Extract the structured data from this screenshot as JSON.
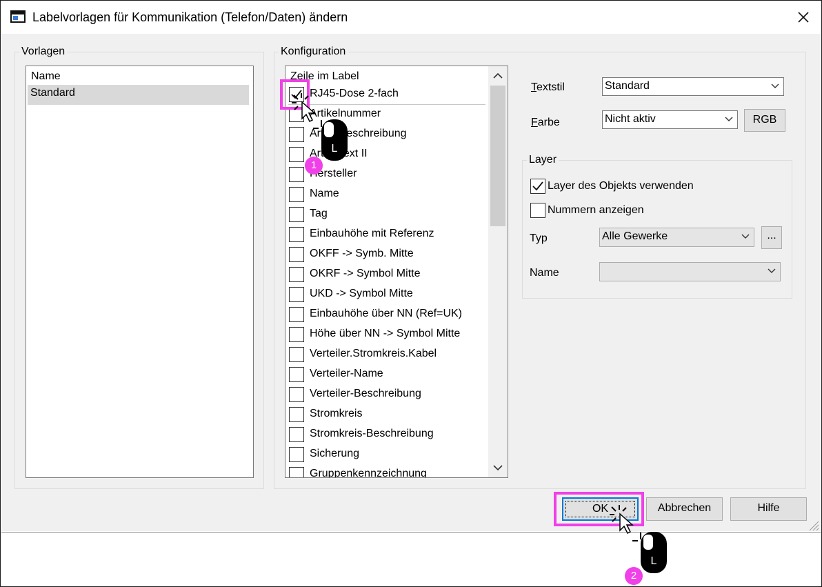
{
  "window": {
    "title": "Labelvorlagen für Kommunikation (Telefon/Daten) ändern"
  },
  "vorlagen": {
    "legend": "Vorlagen",
    "header": "Name",
    "items": [
      "Standard"
    ]
  },
  "konfiguration": {
    "legend": "Konfiguration",
    "list_header": "Zeile im Label",
    "items": [
      {
        "label": "RJ45-Dose 2-fach",
        "checked": true
      },
      {
        "label": "Artikelnummer",
        "checked": false
      },
      {
        "label": "Artikelbeschreibung",
        "checked": false
      },
      {
        "label": "Artikeltext II",
        "checked": false
      },
      {
        "label": "Hersteller",
        "checked": false
      },
      {
        "label": "Name",
        "checked": false
      },
      {
        "label": "Tag",
        "checked": false
      },
      {
        "label": "Einbauhöhe mit Referenz",
        "checked": false
      },
      {
        "label": "OKFF -> Symb. Mitte",
        "checked": false
      },
      {
        "label": "OKRF -> Symbol Mitte",
        "checked": false
      },
      {
        "label": "UKD -> Symbol Mitte",
        "checked": false
      },
      {
        "label": "Einbauhöhe über NN (Ref=UK)",
        "checked": false
      },
      {
        "label": "Höhe über NN -> Symbol Mitte",
        "checked": false
      },
      {
        "label": "Verteiler.Stromkreis.Kabel",
        "checked": false
      },
      {
        "label": "Verteiler-Name",
        "checked": false
      },
      {
        "label": "Verteiler-Beschreibung",
        "checked": false
      },
      {
        "label": "Stromkreis",
        "checked": false
      },
      {
        "label": "Stromkreis-Beschreibung",
        "checked": false
      },
      {
        "label": "Sicherung",
        "checked": false
      },
      {
        "label": "Gruppenkennzeichnung",
        "checked": false
      }
    ],
    "textstil_label": "Textstil",
    "textstil_value": "Standard",
    "farbe_label": "Farbe",
    "farbe_value": "Nicht aktiv",
    "rgb_button": "RGB"
  },
  "layer": {
    "legend": "Layer",
    "use_object_layer_label": "Layer des Objekts verwenden",
    "use_object_layer_checked": true,
    "show_numbers_label": "Nummern anzeigen",
    "show_numbers_checked": false,
    "typ_label": "Typ",
    "typ_value": "Alle Gewerke",
    "browse_button": "...",
    "name_label": "Name",
    "name_value": ""
  },
  "buttons": {
    "ok": "OK",
    "cancel": "Abbrechen",
    "help": "Hilfe"
  },
  "annotations": {
    "step1": "1",
    "step2": "2",
    "mouse_button": "L",
    "highlight_color": "#f040e8"
  },
  "icons": [
    "app-window-icon",
    "close-icon",
    "chevron-down-icon",
    "chevron-up-icon",
    "checkmark-icon",
    "mouse-icon",
    "cursor-icon"
  ]
}
